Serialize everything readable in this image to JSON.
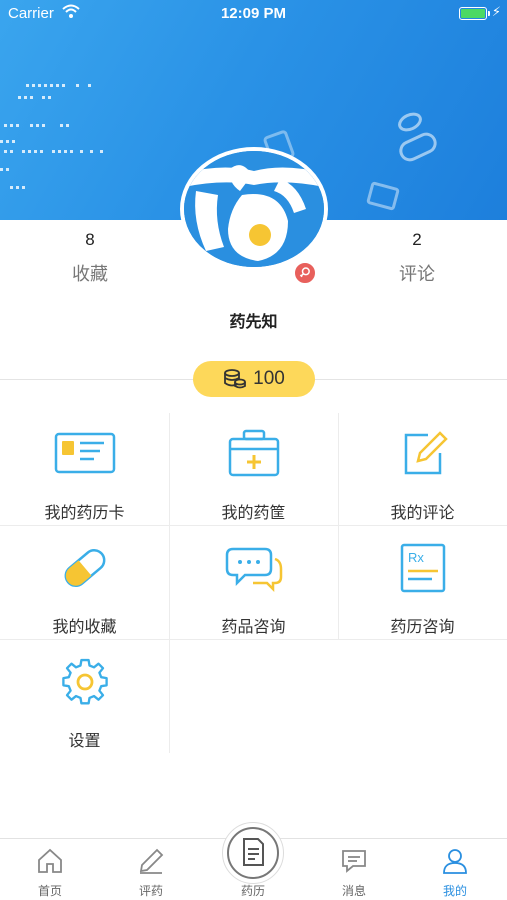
{
  "status_bar": {
    "carrier": "Carrier",
    "time": "12:09 PM"
  },
  "profile": {
    "favorites_count": "8",
    "favorites_label": "收藏",
    "comments_count": "2",
    "comments_label": "评论",
    "username": "药先知",
    "points": "100"
  },
  "menu": [
    {
      "label": "我的药历卡",
      "icon": "id-card-icon"
    },
    {
      "label": "我的药筐",
      "icon": "medicine-box-icon"
    },
    {
      "label": "我的评论",
      "icon": "edit-note-icon"
    },
    {
      "label": "我的收藏",
      "icon": "pill-capsule-icon"
    },
    {
      "label": "药品咨询",
      "icon": "chat-bubbles-icon"
    },
    {
      "label": "药历咨询",
      "icon": "prescription-icon"
    },
    {
      "label": "设置",
      "icon": "gear-icon"
    }
  ],
  "tabbar": [
    {
      "label": "首页",
      "icon": "home-icon"
    },
    {
      "label": "评药",
      "icon": "pencil-icon"
    },
    {
      "label": "药历",
      "icon": "document-icon"
    },
    {
      "label": "消息",
      "icon": "message-icon"
    },
    {
      "label": "我的",
      "icon": "person-icon",
      "active": true
    }
  ],
  "colors": {
    "accent": "#2a8fe0",
    "icon_blue": "#3aaee8",
    "icon_yellow": "#f6c533",
    "points_bg": "#fdd85a",
    "badge_female": "#e8605c"
  }
}
